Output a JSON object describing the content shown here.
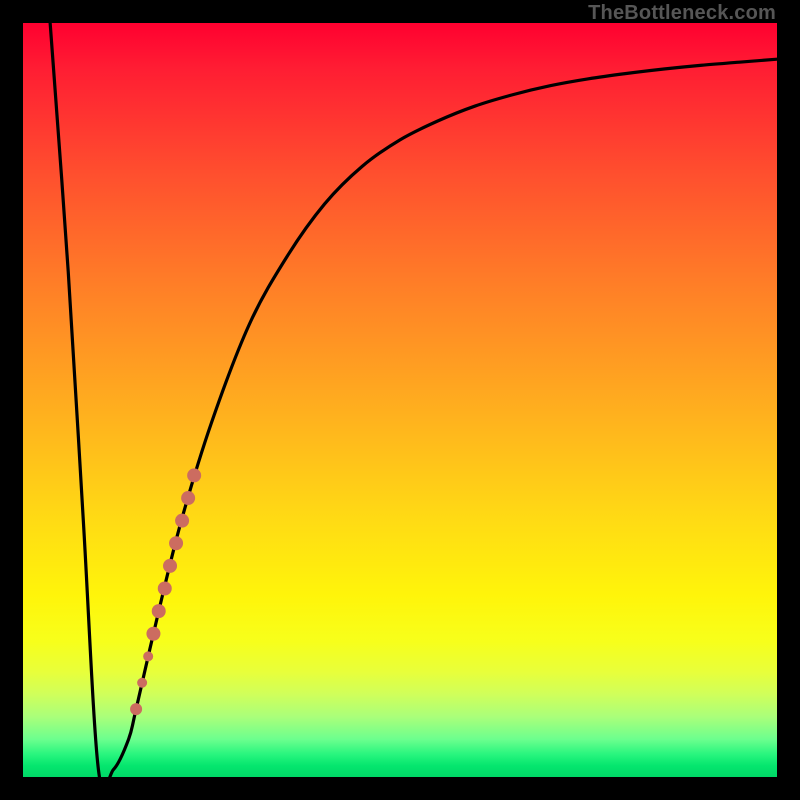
{
  "attribution": "TheBottleneck.com",
  "chart_data": {
    "type": "line",
    "title": "",
    "xlabel": "",
    "ylabel": "",
    "xlim": [
      0,
      100
    ],
    "ylim": [
      0,
      100
    ],
    "series": [
      {
        "name": "bottleneck-curve",
        "x": [
          3.6,
          6,
          8,
          10,
          12,
          14,
          15,
          18,
          21,
          25,
          30,
          35,
          40,
          45,
          50,
          55,
          60,
          65,
          70,
          75,
          80,
          85,
          90,
          95,
          100
        ],
        "values": [
          100,
          67,
          34,
          1.0,
          1.0,
          5.0,
          9.0,
          22,
          34,
          47,
          60,
          69,
          76,
          81,
          84.5,
          87,
          89,
          90.5,
          91.7,
          92.6,
          93.3,
          93.9,
          94.4,
          94.8,
          95.2
        ]
      }
    ],
    "markers": {
      "name": "highlight-dots",
      "color": "#cc6c60",
      "points": [
        {
          "x": 15.0,
          "y": 9.0,
          "r": 6
        },
        {
          "x": 15.8,
          "y": 12.5,
          "r": 5
        },
        {
          "x": 16.6,
          "y": 16.0,
          "r": 5
        },
        {
          "x": 17.3,
          "y": 19.0,
          "r": 7
        },
        {
          "x": 18.0,
          "y": 22.0,
          "r": 7
        },
        {
          "x": 18.8,
          "y": 25.0,
          "r": 7
        },
        {
          "x": 19.5,
          "y": 28.0,
          "r": 7
        },
        {
          "x": 20.3,
          "y": 31.0,
          "r": 7
        },
        {
          "x": 21.1,
          "y": 34.0,
          "r": 7
        },
        {
          "x": 21.9,
          "y": 37.0,
          "r": 7
        },
        {
          "x": 22.7,
          "y": 40.0,
          "r": 7
        }
      ]
    }
  }
}
